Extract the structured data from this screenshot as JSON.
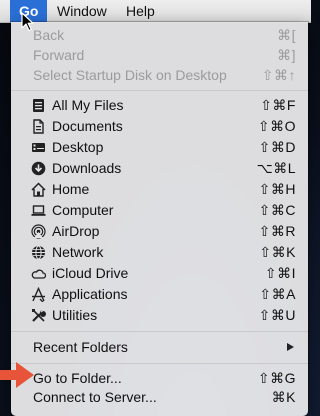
{
  "menubar": {
    "items": [
      {
        "label": "Go"
      },
      {
        "label": "Window"
      },
      {
        "label": "Help"
      }
    ]
  },
  "menu": {
    "group1": [
      {
        "label": "Back",
        "shortcut": "⌘[",
        "enabled": false
      },
      {
        "label": "Forward",
        "shortcut": "⌘]",
        "enabled": false
      },
      {
        "label": "Select Startup Disk on Desktop",
        "shortcut": "⇧⌘↑",
        "enabled": false
      }
    ],
    "group2": [
      {
        "label": "All My Files",
        "shortcut": "⇧⌘F",
        "icon": "all-files-icon"
      },
      {
        "label": "Documents",
        "shortcut": "⇧⌘O",
        "icon": "documents-icon"
      },
      {
        "label": "Desktop",
        "shortcut": "⇧⌘D",
        "icon": "desktop-icon"
      },
      {
        "label": "Downloads",
        "shortcut": "⌥⌘L",
        "icon": "downloads-icon"
      },
      {
        "label": "Home",
        "shortcut": "⇧⌘H",
        "icon": "home-icon"
      },
      {
        "label": "Computer",
        "shortcut": "⇧⌘C",
        "icon": "computer-icon"
      },
      {
        "label": "AirDrop",
        "shortcut": "⇧⌘R",
        "icon": "airdrop-icon"
      },
      {
        "label": "Network",
        "shortcut": "⇧⌘K",
        "icon": "network-icon"
      },
      {
        "label": "iCloud Drive",
        "shortcut": "⇧⌘I",
        "icon": "icloud-icon"
      },
      {
        "label": "Applications",
        "shortcut": "⇧⌘A",
        "icon": "applications-icon"
      },
      {
        "label": "Utilities",
        "shortcut": "⇧⌘U",
        "icon": "utilities-icon"
      }
    ],
    "recent_folders": {
      "label": "Recent Folders"
    },
    "group4": [
      {
        "label": "Go to Folder...",
        "shortcut": "⇧⌘G"
      },
      {
        "label": "Connect to Server...",
        "shortcut": "⌘K"
      }
    ]
  },
  "colors": {
    "accent": "#2a6fd6",
    "pointer": "#e8543a",
    "disabled": "#9b9b9b"
  }
}
